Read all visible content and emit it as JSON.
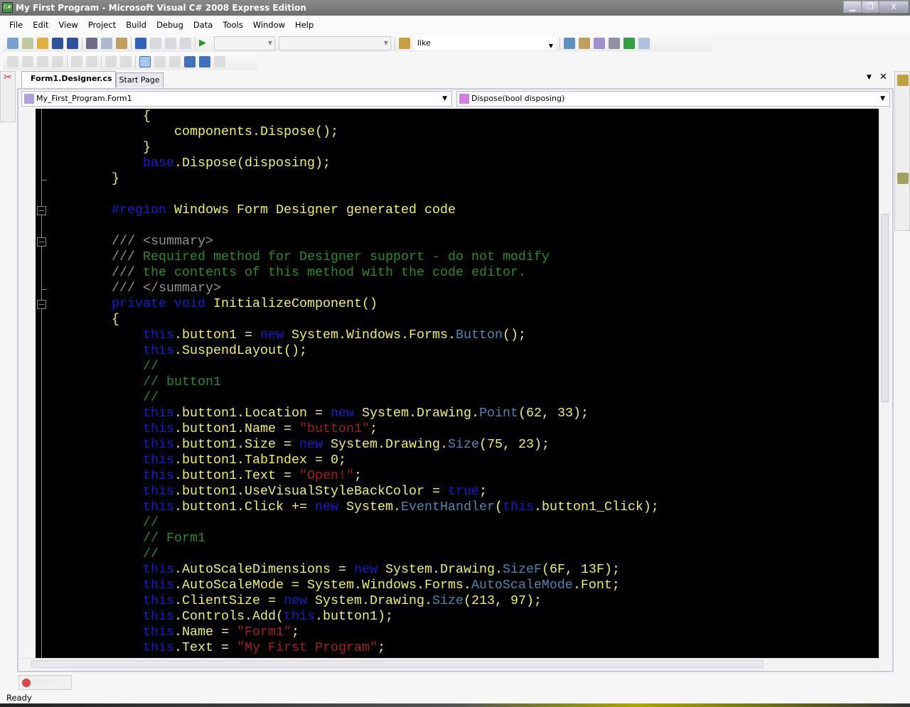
{
  "window": {
    "title": "My First Program - Microsoft Visual C# 2008 Express Edition",
    "icon": "csharp-icon",
    "minimize": "▁",
    "restore": "❐",
    "close": "X"
  },
  "menu": [
    "File",
    "Edit",
    "View",
    "Project",
    "Build",
    "Debug",
    "Data",
    "Tools",
    "Window",
    "Help"
  ],
  "toolbar": {
    "find_value": "like"
  },
  "tabs": [
    {
      "label": "Form1.Designer.cs",
      "active": true
    },
    {
      "label": "Start Page",
      "active": false
    }
  ],
  "tab_controls": {
    "dropdown": "▼",
    "close": "✕"
  },
  "nav": {
    "class_combo": "My_First_Program.Form1",
    "member_combo": "Dispose(bool disposing)"
  },
  "colors": {
    "background": "#000000",
    "identifier": "#f0f060",
    "keyword": "#1a1ad0",
    "type": "#4a86b0",
    "string": "#a02020",
    "comment": "#2a8a2a",
    "doc": "#909090"
  },
  "code": [
    [
      [
        "p",
        "            {"
      ]
    ],
    [
      [
        "p",
        "                components.Dispose();"
      ]
    ],
    [
      [
        "p",
        "            }"
      ]
    ],
    [
      [
        "p",
        "            "
      ],
      [
        "k",
        "base"
      ],
      [
        "p",
        ".Dispose(disposing);"
      ]
    ],
    [
      [
        "p",
        "        }"
      ]
    ],
    [
      [
        "p",
        ""
      ]
    ],
    [
      [
        "p",
        "        "
      ],
      [
        "k",
        "#region"
      ],
      [
        "p",
        " Windows Form Designer generated code"
      ]
    ],
    [
      [
        "p",
        ""
      ]
    ],
    [
      [
        "p",
        "        "
      ],
      [
        "d",
        "/// <summary>"
      ]
    ],
    [
      [
        "p",
        "        "
      ],
      [
        "d",
        "///"
      ],
      [
        "c",
        " Required method for Designer support - do not modify"
      ]
    ],
    [
      [
        "p",
        "        "
      ],
      [
        "d",
        "///"
      ],
      [
        "c",
        " the contents of this method with the code editor."
      ]
    ],
    [
      [
        "p",
        "        "
      ],
      [
        "d",
        "/// </summary>"
      ]
    ],
    [
      [
        "p",
        "        "
      ],
      [
        "k",
        "private"
      ],
      [
        "p",
        " "
      ],
      [
        "k",
        "void"
      ],
      [
        "p",
        " InitializeComponent()"
      ]
    ],
    [
      [
        "p",
        "        {"
      ]
    ],
    [
      [
        "p",
        "            "
      ],
      [
        "k",
        "this"
      ],
      [
        "p",
        ".button1 = "
      ],
      [
        "k",
        "new"
      ],
      [
        "p",
        " System.Windows.Forms."
      ],
      [
        "t",
        "Button"
      ],
      [
        "p",
        "();"
      ]
    ],
    [
      [
        "p",
        "            "
      ],
      [
        "k",
        "this"
      ],
      [
        "p",
        ".SuspendLayout();"
      ]
    ],
    [
      [
        "p",
        "            "
      ],
      [
        "c",
        "//"
      ]
    ],
    [
      [
        "p",
        "            "
      ],
      [
        "c",
        "// button1"
      ]
    ],
    [
      [
        "p",
        "            "
      ],
      [
        "c",
        "//"
      ]
    ],
    [
      [
        "p",
        "            "
      ],
      [
        "k",
        "this"
      ],
      [
        "p",
        ".button1.Location = "
      ],
      [
        "k",
        "new"
      ],
      [
        "p",
        " System.Drawing."
      ],
      [
        "t",
        "Point"
      ],
      [
        "p",
        "(62, 33);"
      ]
    ],
    [
      [
        "p",
        "            "
      ],
      [
        "k",
        "this"
      ],
      [
        "p",
        ".button1.Name = "
      ],
      [
        "s",
        "\"button1\""
      ],
      [
        "p",
        ";"
      ]
    ],
    [
      [
        "p",
        "            "
      ],
      [
        "k",
        "this"
      ],
      [
        "p",
        ".button1.Size = "
      ],
      [
        "k",
        "new"
      ],
      [
        "p",
        " System.Drawing."
      ],
      [
        "t",
        "Size"
      ],
      [
        "p",
        "(75, 23);"
      ]
    ],
    [
      [
        "p",
        "            "
      ],
      [
        "k",
        "this"
      ],
      [
        "p",
        ".button1.TabIndex = 0;"
      ]
    ],
    [
      [
        "p",
        "            "
      ],
      [
        "k",
        "this"
      ],
      [
        "p",
        ".button1.Text = "
      ],
      [
        "s",
        "\"Open!\""
      ],
      [
        "p",
        ";"
      ]
    ],
    [
      [
        "p",
        "            "
      ],
      [
        "k",
        "this"
      ],
      [
        "p",
        ".button1.UseVisualStyleBackColor = "
      ],
      [
        "k",
        "true"
      ],
      [
        "p",
        ";"
      ]
    ],
    [
      [
        "p",
        "            "
      ],
      [
        "k",
        "this"
      ],
      [
        "p",
        ".button1.Click += "
      ],
      [
        "k",
        "new"
      ],
      [
        "p",
        " System."
      ],
      [
        "t",
        "EventHandler"
      ],
      [
        "p",
        "("
      ],
      [
        "k",
        "this"
      ],
      [
        "p",
        ".button1_Click);"
      ]
    ],
    [
      [
        "p",
        "            "
      ],
      [
        "c",
        "//"
      ]
    ],
    [
      [
        "p",
        "            "
      ],
      [
        "c",
        "// Form1"
      ]
    ],
    [
      [
        "p",
        "            "
      ],
      [
        "c",
        "//"
      ]
    ],
    [
      [
        "p",
        "            "
      ],
      [
        "k",
        "this"
      ],
      [
        "p",
        ".AutoScaleDimensions = "
      ],
      [
        "k",
        "new"
      ],
      [
        "p",
        " System.Drawing."
      ],
      [
        "t",
        "SizeF"
      ],
      [
        "p",
        "(6F, 13F);"
      ]
    ],
    [
      [
        "p",
        "            "
      ],
      [
        "k",
        "this"
      ],
      [
        "p",
        ".AutoScaleMode = System.Windows.Forms."
      ],
      [
        "t",
        "AutoScaleMode"
      ],
      [
        "p",
        ".Font;"
      ]
    ],
    [
      [
        "p",
        "            "
      ],
      [
        "k",
        "this"
      ],
      [
        "p",
        ".ClientSize = "
      ],
      [
        "k",
        "new"
      ],
      [
        "p",
        " System.Drawing."
      ],
      [
        "t",
        "Size"
      ],
      [
        "p",
        "(213, 97);"
      ]
    ],
    [
      [
        "p",
        "            "
      ],
      [
        "k",
        "this"
      ],
      [
        "p",
        ".Controls.Add("
      ],
      [
        "k",
        "this"
      ],
      [
        "p",
        ".button1);"
      ]
    ],
    [
      [
        "p",
        "            "
      ],
      [
        "k",
        "this"
      ],
      [
        "p",
        ".Name = "
      ],
      [
        "s",
        "\"Form1\""
      ],
      [
        "p",
        ";"
      ]
    ],
    [
      [
        "p",
        "            "
      ],
      [
        "k",
        "this"
      ],
      [
        "p",
        ".Text = "
      ],
      [
        "s",
        "\"My First Program\""
      ],
      [
        "p",
        ";"
      ]
    ]
  ],
  "bottom_tabs": {
    "error_list": "Error List"
  },
  "status": {
    "text": "Ready"
  }
}
